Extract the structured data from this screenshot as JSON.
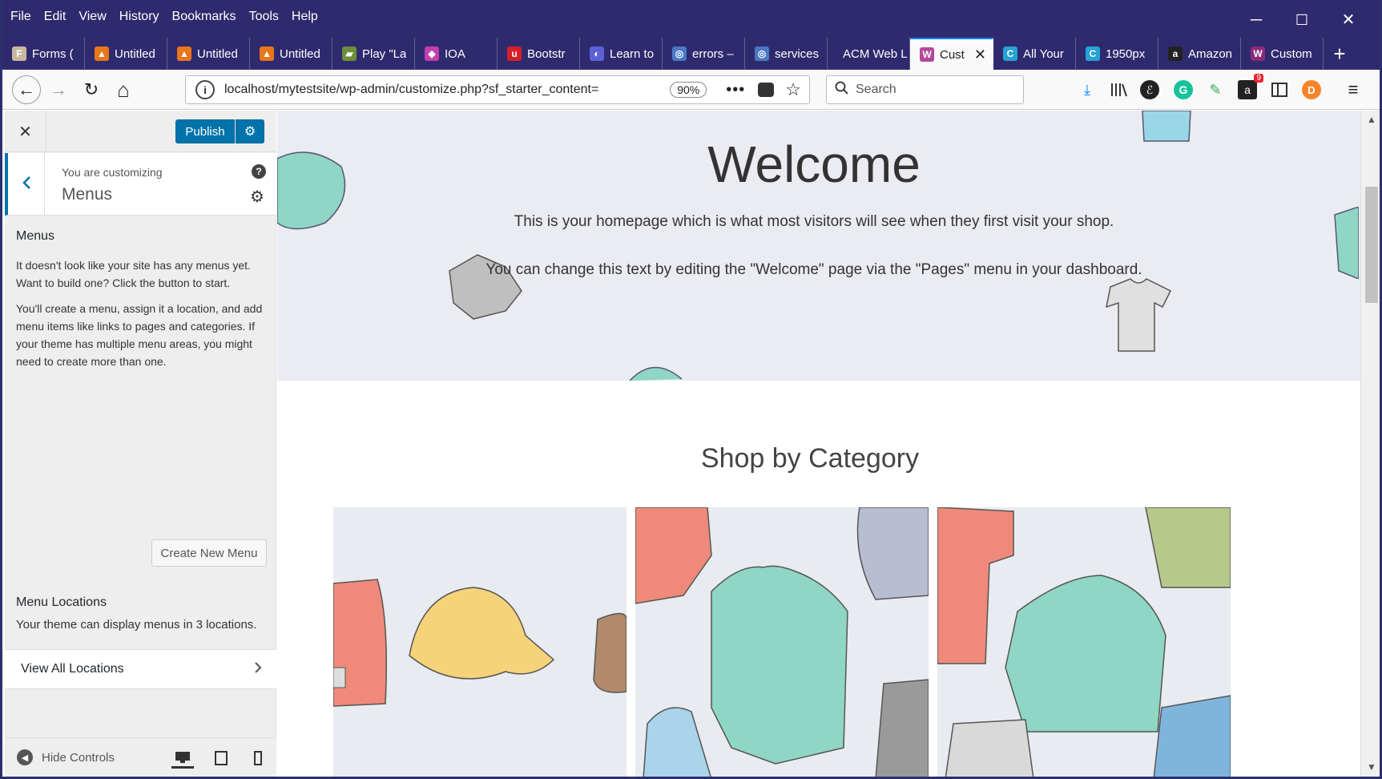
{
  "menubar": [
    "File",
    "Edit",
    "View",
    "History",
    "Bookmarks",
    "Tools",
    "Help"
  ],
  "window_controls": {
    "minimize": "─",
    "maximize": "☐",
    "close": "✕"
  },
  "tabs": [
    {
      "title": "Forms (",
      "color": "#c9b89e",
      "glyph": "F"
    },
    {
      "title": "Untitled",
      "color": "#e8761a",
      "glyph": "▲"
    },
    {
      "title": "Untitled",
      "color": "#e8761a",
      "glyph": "▲"
    },
    {
      "title": "Untitled",
      "color": "#e8761a",
      "glyph": "▲"
    },
    {
      "title": "Play \"La",
      "color": "#6b8e3a",
      "glyph": "▰"
    },
    {
      "title": "IOA",
      "color": "#c13fb0",
      "glyph": "◆"
    },
    {
      "title": "Bootstr",
      "color": "#d42027",
      "glyph": "u"
    },
    {
      "title": "Learn to",
      "color": "#5c62d6",
      "glyph": "◐"
    },
    {
      "title": "errors –",
      "color": "#4a78c2",
      "glyph": "◎"
    },
    {
      "title": "services",
      "color": "#4a78c2",
      "glyph": "◎"
    },
    {
      "title": "ACM Web L",
      "color": "transparent",
      "glyph": ""
    },
    {
      "title": "Cust",
      "color": "#b5489a",
      "glyph": "W",
      "active": true
    },
    {
      "title": "All Your",
      "color": "#25a3d6",
      "glyph": "C"
    },
    {
      "title": "1950px",
      "color": "#25a3d6",
      "glyph": "C"
    },
    {
      "title": "Amazon",
      "color": "#222222",
      "glyph": "a"
    },
    {
      "title": "Custom",
      "color": "#8b2a7a",
      "glyph": "W"
    }
  ],
  "active_tab_close": "✕",
  "new_tab": "+",
  "nav": {
    "back": "←",
    "forward": "→",
    "reload": "↻",
    "home": "⌂",
    "url": "localhost/mytestsite/wp-admin/customize.php?sf_starter_content=",
    "zoom": "90%",
    "more": "•••",
    "star": "☆",
    "search_placeholder": "Search"
  },
  "toolbar_icons": [
    "download-icon",
    "library-icon",
    "evernote-icon",
    "grammarly-icon",
    "eyedropper-icon",
    "amazon-assistant-icon",
    "sidebar-icon",
    "extension-icon",
    "hamburger-menu-icon"
  ],
  "amazon_badge": "9",
  "customizer": {
    "close": "✕",
    "publish": "Publish",
    "you_are_customizing": "You are customizing",
    "section": "Menus",
    "heading": "Menus",
    "para1": "It doesn't look like your site has any menus yet. Want to build one? Click the button to start.",
    "para2": "You'll create a menu, assign it a location, and add menu items like links to pages and categories. If your theme has multiple menu areas, you might need to create more than one.",
    "create_button": "Create New Menu",
    "locations_heading": "Menu Locations",
    "locations_text": "Your theme can display menus in 3 locations.",
    "view_all": "View All Locations",
    "hide_controls": "Hide Controls"
  },
  "preview": {
    "welcome": "Welcome",
    "hero_p1": "This is your homepage which is what most visitors will see when they first visit your shop.",
    "hero_p2": "You can change this text by editing the \"Welcome\" page via the \"Pages\" menu in your dashboard.",
    "shop_heading": "Shop by Category"
  },
  "colors": {
    "browser_chrome": "#2f2a6e",
    "wp_blue": "#0073aa",
    "hero_bg": "#eaecf1"
  }
}
